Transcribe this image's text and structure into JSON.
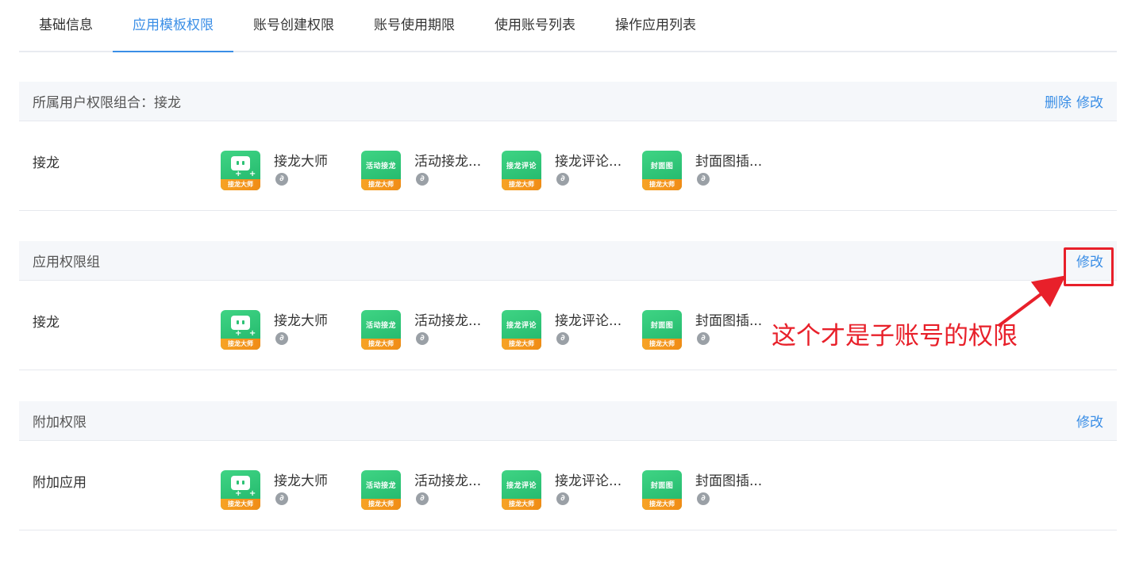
{
  "tabs": [
    {
      "label": "基础信息",
      "active": false
    },
    {
      "label": "应用模板权限",
      "active": true
    },
    {
      "label": "账号创建权限",
      "active": false
    },
    {
      "label": "账号使用期限",
      "active": false
    },
    {
      "label": "使用账号列表",
      "active": false
    },
    {
      "label": "操作应用列表",
      "active": false
    }
  ],
  "sections": [
    {
      "title": "所属用户权限组合：接龙",
      "actions": [
        "删除",
        "修改"
      ],
      "row_label": "接龙"
    },
    {
      "title": "应用权限组",
      "actions": [
        "修改"
      ],
      "row_label": "接龙"
    },
    {
      "title": "附加权限",
      "actions": [
        "修改"
      ],
      "row_label": "附加应用"
    }
  ],
  "apps": [
    {
      "name": "接龙大师",
      "icon_text": "",
      "band": "接龙大师",
      "icon": "robot-icon"
    },
    {
      "name": "活动接龙...",
      "icon_text": "活动接龙",
      "band": "接龙大师",
      "icon": "app-icon"
    },
    {
      "name": "接龙评论...",
      "icon_text": "接龙评论",
      "band": "接龙大师",
      "icon": "app-icon"
    },
    {
      "name": "封面图插...",
      "icon_text": "封面图",
      "band": "接龙大师",
      "icon": "app-icon"
    }
  ],
  "mini_icon_glyph": "∂",
  "annotation": {
    "text": "这个才是子账号的权限",
    "color": "#e8202a"
  },
  "colors": {
    "accent": "#3a8ee6",
    "header_bg": "#f5f7fa",
    "icon_green": "#2dc275",
    "icon_orange": "#f39a1e"
  }
}
